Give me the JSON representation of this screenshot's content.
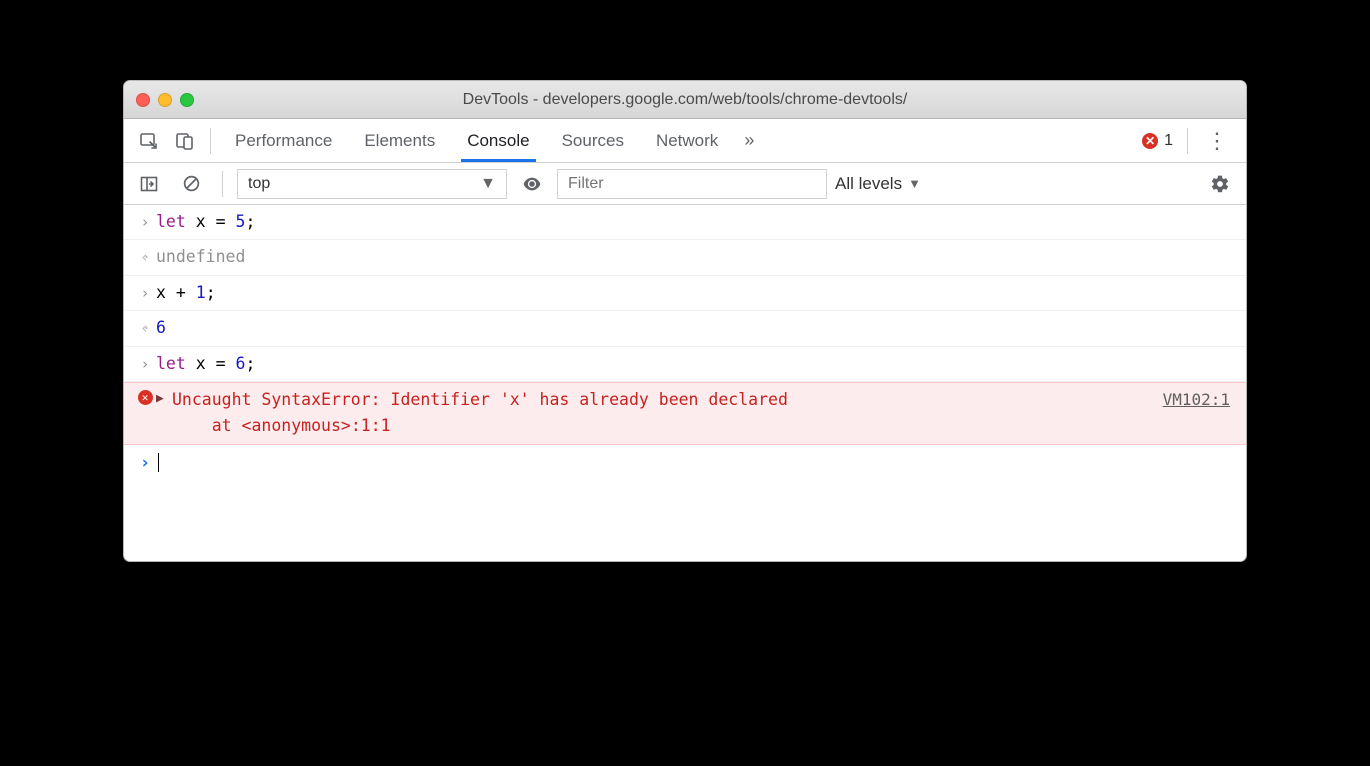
{
  "window": {
    "title": "DevTools - developers.google.com/web/tools/chrome-devtools/"
  },
  "topbar": {
    "tabs": [
      "Performance",
      "Elements",
      "Console",
      "Sources",
      "Network"
    ],
    "active_tab": "Console",
    "more_symbol": "»",
    "error_count": "1"
  },
  "subbar": {
    "context": "top",
    "filter_placeholder": "Filter",
    "levels_label": "All levels"
  },
  "console": {
    "lines": [
      {
        "kind": "input",
        "tokens": [
          [
            "kw",
            "let"
          ],
          [
            "",
            " x "
          ],
          [
            "",
            "= "
          ],
          [
            "num",
            "5"
          ],
          [
            "",
            ";"
          ]
        ]
      },
      {
        "kind": "output",
        "tokens": [
          [
            "undef",
            "undefined"
          ]
        ]
      },
      {
        "kind": "input",
        "tokens": [
          [
            "",
            "x + "
          ],
          [
            "num",
            "1"
          ],
          [
            "",
            ";"
          ]
        ]
      },
      {
        "kind": "output",
        "tokens": [
          [
            "num",
            "6"
          ]
        ]
      },
      {
        "kind": "input",
        "tokens": [
          [
            "kw",
            "let"
          ],
          [
            "",
            " x "
          ],
          [
            "",
            "= "
          ],
          [
            "num",
            "6"
          ],
          [
            "",
            ";"
          ]
        ]
      }
    ],
    "error": {
      "message": "Uncaught SyntaxError: Identifier 'x' has already been declared\n    at <anonymous>:1:1",
      "source": "VM102:1"
    }
  }
}
